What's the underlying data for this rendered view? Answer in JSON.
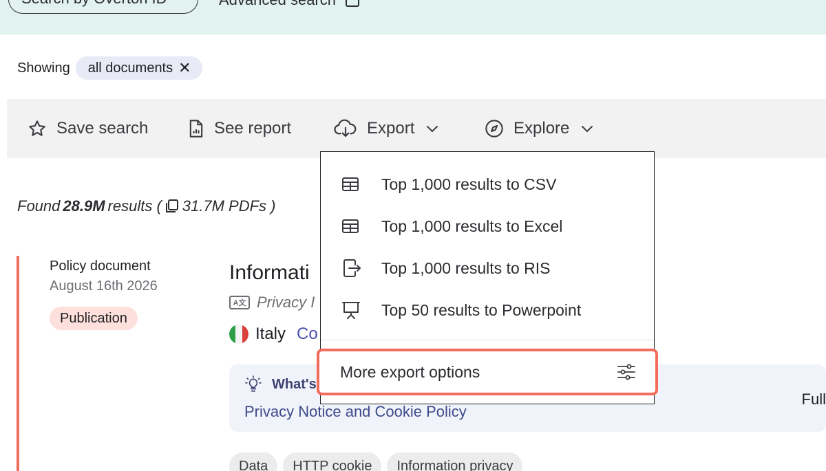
{
  "search_band": {
    "search_pill": "Search by Overton ID",
    "advanced_search": "Advanced search"
  },
  "filters": {
    "showing_label": "Showing",
    "active_chip": "all documents"
  },
  "toolbar": {
    "save_search": "Save search",
    "see_report": "See report",
    "export": "Export",
    "explore": "Explore"
  },
  "results": {
    "found_prefix": "Found",
    "count": "28.9M",
    "results_word": "results (",
    "pdfs": "31.7M PDFs )"
  },
  "result_card": {
    "doc_type": "Policy document",
    "date": "August 16th 2026",
    "tag": "Publication",
    "title": "Informati",
    "translated_title": "Privacy I",
    "country": "Italy",
    "country_link": "Co",
    "summary_heading": "What's",
    "summary_link": "Privacy Notice and Cookie Policy",
    "full_text": "Full",
    "topics": [
      "Data",
      "HTTP cookie",
      "Information privacy"
    ]
  },
  "export_menu": {
    "items": [
      {
        "label": "Top 1,000 results to CSV",
        "icon": "table-icon"
      },
      {
        "label": "Top 1,000 results to Excel",
        "icon": "table-icon"
      },
      {
        "label": "Top 1,000 results to RIS",
        "icon": "export-file-icon"
      },
      {
        "label": "Top 50 results to Powerpoint",
        "icon": "presentation-icon"
      }
    ],
    "more_options": "More export options"
  },
  "colors": {
    "accent_highlight": "#f26b5b",
    "search_band": "#e2f3ef",
    "chip_bg": "#e8eaf6",
    "publication_tag_bg": "#fde0dc",
    "link": "#4a4fa8"
  }
}
